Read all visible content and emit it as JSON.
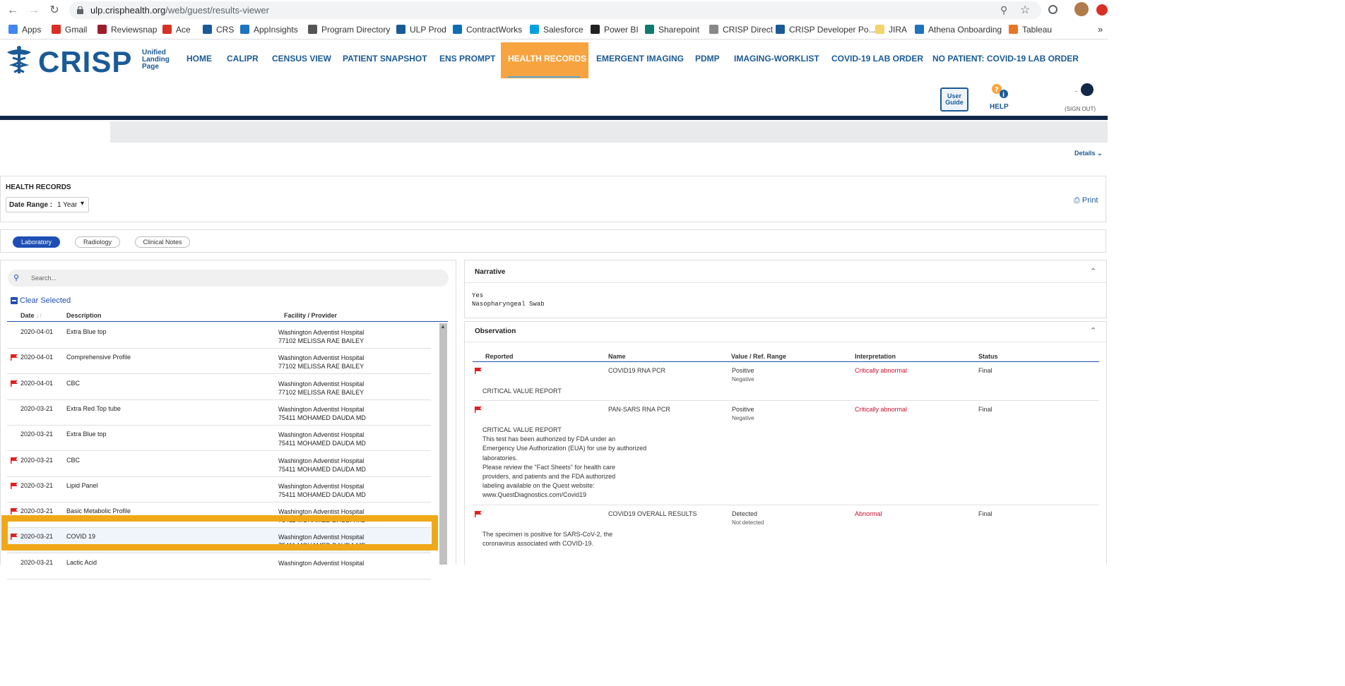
{
  "browser": {
    "url_host": "ulp.crisphealth.org",
    "url_path": "/web/guest/results-viewer",
    "bookmarks": [
      "Apps",
      "Gmail",
      "Reviewsnap",
      "Ace",
      "CRS",
      "AppInsights",
      "Program Directory",
      "ULP Prod",
      "ContractWorks",
      "Salesforce",
      "Power BI",
      "Sharepoint",
      "CRISP Direct",
      "CRISP Developer Po...",
      "JIRA",
      "Athena Onboarding",
      "Tableau"
    ],
    "more": "»"
  },
  "header": {
    "logo": "CRISP",
    "logo_sub": "Unified Landing Page",
    "nav": [
      "HOME",
      "CALIPR",
      "CENSUS VIEW",
      "PATIENT SNAPSHOT",
      "ENS PROMPT",
      "HEALTH RECORDS",
      "EMERGENT IMAGING",
      "PDMP",
      "IMAGING-WORKLIST",
      "COVID-19 LAB ORDER",
      "NO PATIENT: COVID-19 LAB ORDER"
    ],
    "user_guide": "User Guide",
    "help": "HELP",
    "dash": "-",
    "sign_out": "(SIGN OUT)",
    "accent": "#f7a440",
    "brand": "#1a5a96"
  },
  "details_label": "Details",
  "records": {
    "title": "HEALTH RECORDS",
    "date_range_label": "Date Range :",
    "date_range_value": "1 Year",
    "print": "Print"
  },
  "tabs": [
    "Laboratory",
    "Radiology",
    "Clinical Notes"
  ],
  "list": {
    "search_placeholder": "Search...",
    "clear_selected": "Clear Selected",
    "columns": [
      "Date",
      "Description",
      "Facility / Provider"
    ],
    "rows": [
      {
        "flag": false,
        "date": "2020-04-01",
        "desc": "Extra Blue top",
        "fac": "Washington Adventist Hospital",
        "prov": "77102 MELISSA RAE BAILEY"
      },
      {
        "flag": true,
        "date": "2020-04-01",
        "desc": "Comprehensive Profile",
        "fac": "Washington Adventist Hospital",
        "prov": "77102 MELISSA RAE BAILEY"
      },
      {
        "flag": true,
        "date": "2020-04-01",
        "desc": "CBC",
        "fac": "Washington Adventist Hospital",
        "prov": "77102 MELISSA RAE BAILEY"
      },
      {
        "flag": false,
        "date": "2020-03-21",
        "desc": "Extra Red Top tube",
        "fac": "Washington Adventist Hospital",
        "prov": "75411 MOHAMED DAUDA MD"
      },
      {
        "flag": false,
        "date": "2020-03-21",
        "desc": "Extra Blue top",
        "fac": "Washington Adventist Hospital",
        "prov": "75411 MOHAMED DAUDA MD"
      },
      {
        "flag": true,
        "date": "2020-03-21",
        "desc": "CBC",
        "fac": "Washington Adventist Hospital",
        "prov": "75411 MOHAMED DAUDA MD"
      },
      {
        "flag": true,
        "date": "2020-03-21",
        "desc": "Lipid Panel",
        "fac": "Washington Adventist Hospital",
        "prov": "75411 MOHAMED DAUDA MD"
      },
      {
        "flag": true,
        "date": "2020-03-21",
        "desc": "Basic Metabolic Profile",
        "fac": "Washington Adventist Hospital",
        "prov": "75411 MOHAMED DAUDA MD"
      },
      {
        "flag": true,
        "date": "2020-03-21",
        "desc": "COVID 19",
        "fac": "Washington Adventist Hospital",
        "prov": "75411 MOHAMED DAUDA MD",
        "selected": true
      },
      {
        "flag": false,
        "date": "2020-03-21",
        "desc": "Lactic Acid",
        "fac": "Washington Adventist Hospital",
        "prov": ""
      }
    ]
  },
  "narrative": {
    "title": "Narrative",
    "lines": [
      "Yes",
      "Nasopharyngeal Swab"
    ]
  },
  "observation": {
    "title": "Observation",
    "columns": [
      "Reported",
      "Name",
      "Value / Ref. Range",
      "Interpretation",
      "Status"
    ],
    "rows": [
      {
        "name": "COVID19 RNA PCR",
        "value": "Positive",
        "ref": "Negative",
        "interp": "Critically abnormal",
        "status": "Final",
        "note": [
          "CRITICAL VALUE REPORT"
        ]
      },
      {
        "name": "PAN-SARS RNA PCR",
        "value": "Positive",
        "ref": "Negative",
        "interp": "Critically abnormal",
        "status": "Final",
        "note": [
          "CRITICAL VALUE REPORT",
          "This test has been authorized by FDA under an",
          "Emergency Use Authorization (EUA) for use by authorized",
          "laboratories.",
          "Please review the \"Fact Sheets\" for health care",
          "providers, and patients and the FDA authorized",
          "labeling available on the Quest website:",
          "www.QuestDiagnostics.com/Covid19"
        ]
      },
      {
        "name": "COVID19 OVERALL RESULTS",
        "value": "Detected",
        "ref": "Not detected",
        "interp": "Abnormal",
        "status": "Final",
        "note": [
          "The specimen is positive for SARS-CoV-2, the",
          "coronavirus associated with COVID-19."
        ]
      }
    ]
  },
  "colors": {
    "flag": "#e02020",
    "critical": "#c8102e",
    "selected_border": "#f0a818",
    "nav_dark": "#132848"
  }
}
